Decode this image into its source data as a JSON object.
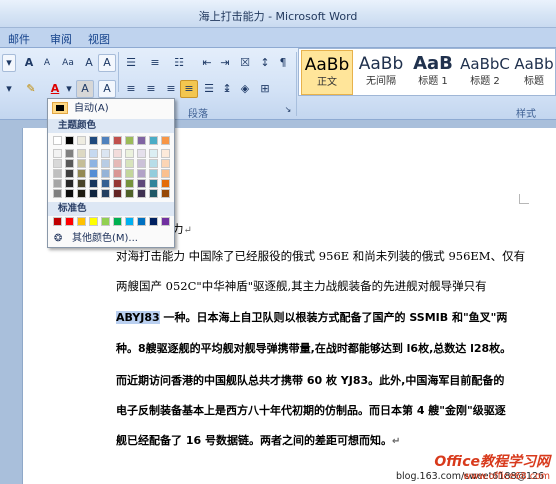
{
  "window": {
    "title": "海上打击能力 - Microsoft Word"
  },
  "tabs": [
    "邮件",
    "审阅",
    "视图"
  ],
  "ribbon": {
    "font_row1": [
      "A",
      "A",
      "Aa",
      "A",
      "A"
    ],
    "font_row2": [
      "A",
      "A",
      "A"
    ],
    "paragraph_label": "段落",
    "styles_label": "样式"
  },
  "styles": [
    {
      "sample": "AaBb",
      "name": "正文",
      "active": true
    },
    {
      "sample": "AaBb",
      "name": "无间隔"
    },
    {
      "sample": "AaB",
      "name": "标题 1"
    },
    {
      "sample": "AaBbC",
      "name": "标题 2"
    },
    {
      "sample": "AaBb",
      "name": "标题"
    }
  ],
  "color_menu": {
    "auto_label": "自动(A)",
    "theme_header": "主题颜色",
    "standard_header": "标准色",
    "more_label": "其他颜色(M)...",
    "theme_top": [
      "#ffffff",
      "#000000",
      "#eeece1",
      "#1f497d",
      "#4f81bd",
      "#c0504d",
      "#9bbb59",
      "#8064a2",
      "#4bacc6",
      "#f79646"
    ],
    "theme_shades": [
      [
        "#f2f2f2",
        "#808080",
        "#ddd9c3",
        "#c6d9f0",
        "#dbe5f1",
        "#f2dcdb",
        "#ebf1dd",
        "#e5e0ec",
        "#dbeef3",
        "#fdeada"
      ],
      [
        "#d8d8d8",
        "#595959",
        "#c4bd97",
        "#8db3e2",
        "#b8cce4",
        "#e5b9b7",
        "#d7e3bc",
        "#ccc1d9",
        "#b7dde8",
        "#fbd5b5"
      ],
      [
        "#bfbfbf",
        "#3f3f3f",
        "#938953",
        "#548dd4",
        "#95b3d7",
        "#d99694",
        "#c3d69b",
        "#b2a2c7",
        "#92cddc",
        "#fac08f"
      ],
      [
        "#a5a5a5",
        "#262626",
        "#494429",
        "#17365d",
        "#366092",
        "#953734",
        "#76923c",
        "#5f497a",
        "#31859b",
        "#e36c09"
      ],
      [
        "#7f7f7f",
        "#0c0c0c",
        "#1d1b10",
        "#0f243e",
        "#244061",
        "#632423",
        "#4f6128",
        "#3f3151",
        "#205867",
        "#974806"
      ]
    ],
    "standard": [
      "#c00000",
      "#ff0000",
      "#ffc000",
      "#ffff00",
      "#92d050",
      "#00b050",
      "#00b0f0",
      "#0070c0",
      "#002060",
      "#7030a0"
    ]
  },
  "document": {
    "heading_partial": "力",
    "lines": [
      "对海打击能力 中国除了已经服役的俄式 956E 和尚未列装的俄式 956EM、仅有",
      "两艘国产 052C\"中华神盾\"驱逐舰,其主力战舰装备的先进舰对舰导弹只有",
      "ABYJ83",
      "一种。日本海上自卫队则以根装方式配备了国产的 SSMIB 和\"鱼叉\"两",
      "种。8艘驱逐舰的平均舰对舰导弹携带量,在战时都能够达到 l6枚,总数达 l28枚。",
      "而近期访问香港的中国舰队总共才携带 60 枚 YJ83。此外,中国海军目前配备的",
      "电子反制装备基本上是西方八十年代初期的仿制品。而日本第 4 艘\"金刚\"级驱逐",
      "舰已经配备了 16 号数据链。两者之间的差距可想而知。"
    ]
  },
  "watermark": {
    "brand": "Office教程学习网",
    "url": "www.office68.com",
    "blog": "blog.163.com/sweet6188@126"
  }
}
